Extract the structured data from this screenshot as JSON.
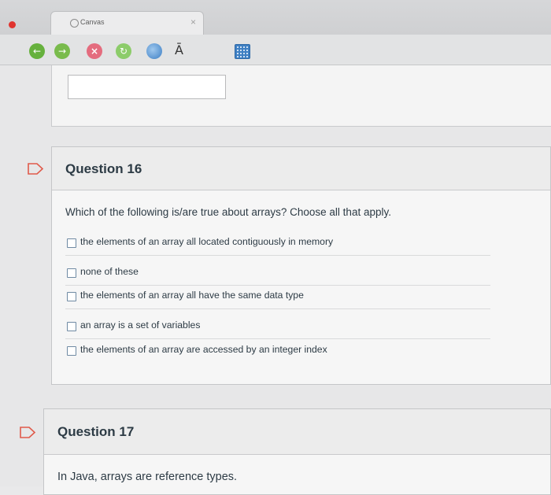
{
  "browser": {
    "tab_title": "Canvas",
    "tab_close": "×",
    "toolbar_letter": "Ā"
  },
  "questions": [
    {
      "title": "Question 16",
      "text": "Which of the following is/are true about arrays? Choose all that apply.",
      "options": [
        "the elements of an array all located contiguously in memory",
        "none of these",
        "the elements of an array all have the same data type",
        "an array is a set of variables",
        "the elements of an array are accessed by an integer index"
      ]
    },
    {
      "title": "Question 17",
      "text": "In Java, arrays are reference types."
    }
  ],
  "colors": {
    "flag_outline": "#e05a4a",
    "checkbox_border": "#6f8aa3",
    "text": "#2d3b45"
  }
}
